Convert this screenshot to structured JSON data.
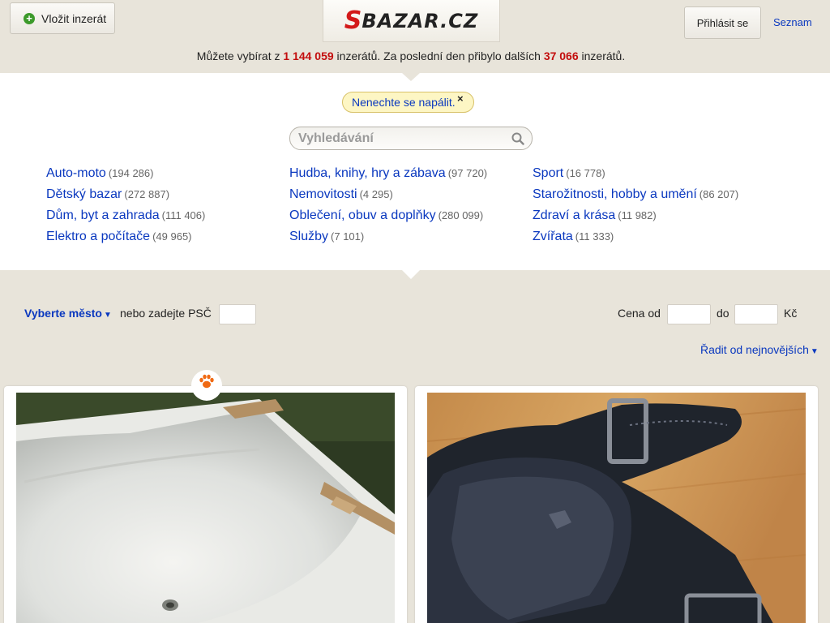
{
  "header": {
    "post_button": "Vložit inzerát",
    "logo_s": "S",
    "logo_rest": "BAZAR.CZ",
    "login_button": "Přihlásit se",
    "seznam_link": "Seznam",
    "stats": {
      "prefix": "Můžete vybírat z",
      "total": "1 144 059",
      "middle": "inzerátů. Za poslední den přibylo dalších",
      "new": "37 066",
      "suffix": "inzerátů."
    }
  },
  "warning": {
    "text": "Nenechte se napálit.",
    "close": "×"
  },
  "search": {
    "placeholder": "Vyhledávání"
  },
  "categories": [
    [
      {
        "label": "Auto-moto",
        "count": "(194 286)"
      },
      {
        "label": "Dětský bazar",
        "count": "(272 887)"
      },
      {
        "label": "Dům, byt a zahrada",
        "count": "(111 406)"
      },
      {
        "label": "Elektro a počítače",
        "count": "(49 965)"
      }
    ],
    [
      {
        "label": "Hudba, knihy, hry a zábava",
        "count": "(97 720)"
      },
      {
        "label": "Nemovitosti",
        "count": "(4 295)"
      },
      {
        "label": "Oblečení, obuv a doplňky",
        "count": "(280 099)"
      },
      {
        "label": "Služby",
        "count": "(7 101)"
      }
    ],
    [
      {
        "label": "Sport",
        "count": "(16 778)"
      },
      {
        "label": "Starožitnosti, hobby a umění",
        "count": "(86 207)"
      },
      {
        "label": "Zdraví a krása",
        "count": "(11 982)"
      },
      {
        "label": "Zvířata",
        "count": "(11 333)"
      }
    ]
  ],
  "filters": {
    "city": "Vyberte město",
    "psc_label": "nebo zadejte PSČ",
    "price_from_label": "Cena od",
    "price_to_label": "do",
    "currency": "Kč",
    "sort": "Řadit od nejnovějších"
  },
  "listings": [
    {
      "image": "bathtub-photo"
    },
    {
      "image": "shoes-photo"
    }
  ],
  "colors": {
    "background": "#e8e4da",
    "link": "#0a38bf",
    "highlight": "#c30e0e",
    "logo_red": "#d31a1a",
    "plus_green": "#3c9a2b",
    "paw_orange": "#f06a14"
  },
  "icons": {
    "post": "plus-circle-icon",
    "search": "search-icon",
    "close": "close-icon",
    "badge": "paw-icon",
    "dropdown": "triangle-down-icon"
  }
}
